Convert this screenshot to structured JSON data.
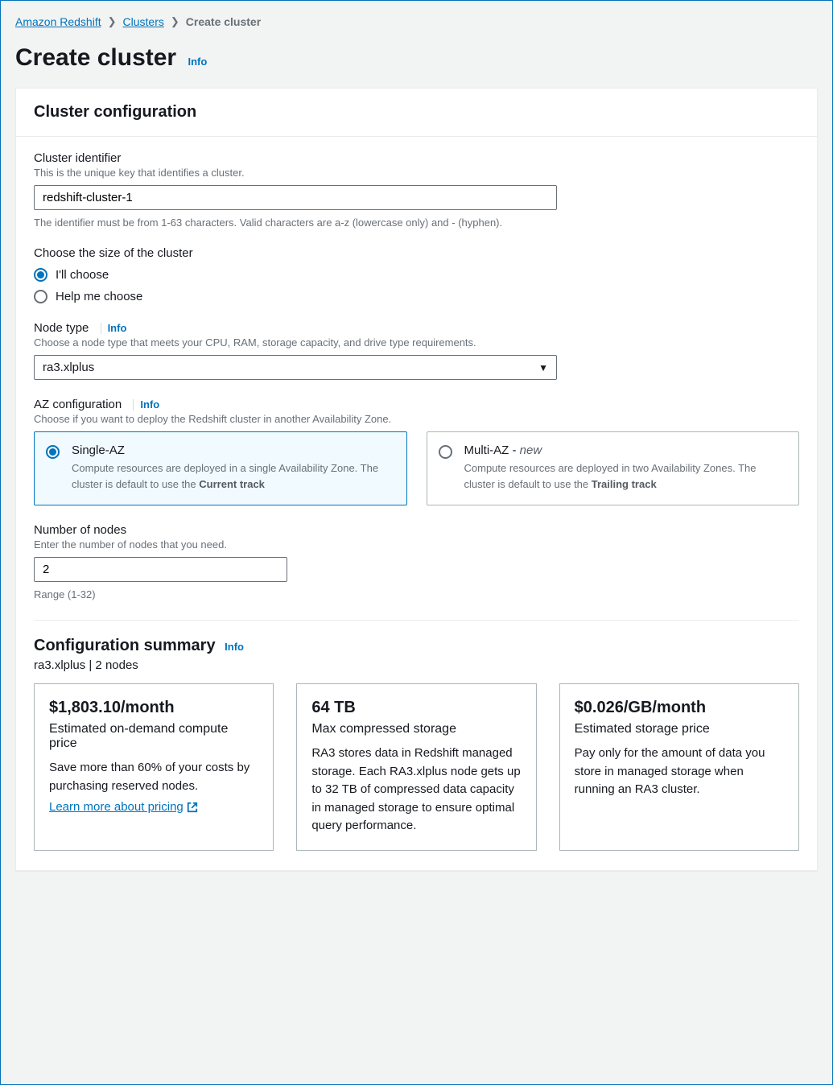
{
  "breadcrumb": {
    "root": "Amazon Redshift",
    "parent": "Clusters",
    "current": "Create cluster"
  },
  "page": {
    "title": "Create cluster",
    "info": "Info"
  },
  "panel": {
    "title": "Cluster configuration"
  },
  "identifier": {
    "label": "Cluster identifier",
    "hint": "This is the unique key that identifies a cluster.",
    "value": "redshift-cluster-1",
    "constraint": "The identifier must be from 1-63 characters. Valid characters are a-z (lowercase only) and - (hyphen)."
  },
  "size": {
    "label": "Choose the size of the cluster",
    "opt1": "I'll choose",
    "opt2": "Help me choose"
  },
  "nodeType": {
    "label": "Node type",
    "info": "Info",
    "hint": "Choose a node type that meets your CPU, RAM, storage capacity, and drive type requirements.",
    "value": "ra3.xlplus"
  },
  "az": {
    "label": "AZ configuration",
    "info": "Info",
    "hint": "Choose if you want to deploy the Redshift cluster in another Availability Zone.",
    "tile1": {
      "title": "Single-AZ",
      "descPrefix": "Compute resources are deployed in a single Availability Zone. The cluster is default to use the ",
      "descBold": "Current track"
    },
    "tile2": {
      "titlePrefix": "Multi-AZ - ",
      "titleNew": "new",
      "descPrefix": "Compute resources are deployed in two Availability Zones. The cluster is default to use the ",
      "descBold": "Trailing track"
    }
  },
  "nodes": {
    "label": "Number of nodes",
    "hint": "Enter the number of nodes that you need.",
    "value": "2",
    "constraint": "Range (1-32)"
  },
  "summary": {
    "title": "Configuration summary",
    "info": "Info",
    "sub": "ra3.xlplus | 2 nodes",
    "card1": {
      "big": "$1,803.10/month",
      "sub": "Estimated on-demand compute price",
      "text": "Save more than 60% of your costs by purchasing reserved nodes.",
      "link": "Learn more about pricing"
    },
    "card2": {
      "big": "64 TB",
      "sub": "Max compressed storage",
      "text": "RA3 stores data in Redshift managed storage. Each RA3.xlplus node gets up to 32 TB of compressed data capacity in managed storage to ensure optimal query performance."
    },
    "card3": {
      "big": "$0.026/GB/month",
      "sub": "Estimated storage price",
      "text": "Pay only for the amount of data you store in managed storage when running an RA3 cluster."
    }
  }
}
